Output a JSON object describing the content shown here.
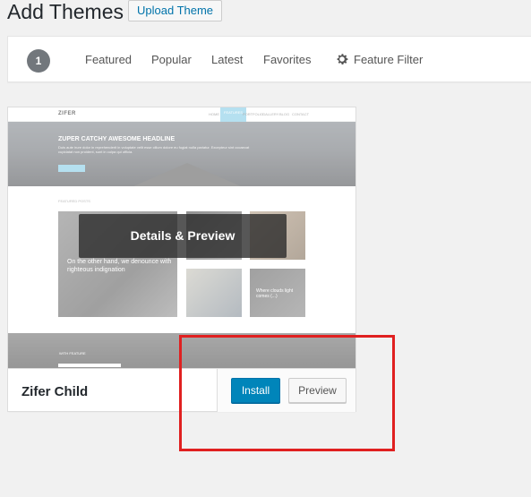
{
  "page": {
    "title": "Add Themes",
    "upload_label": "Upload Theme"
  },
  "filter_bar": {
    "count": "1",
    "tabs": [
      "Featured",
      "Popular",
      "Latest",
      "Favorites"
    ],
    "feature_filter_label": "Feature Filter"
  },
  "theme_card": {
    "name": "Zifer Child",
    "overlay_label": "Details & Preview",
    "install_label": "Install",
    "preview_label": "Preview",
    "screenshot": {
      "logo": "ZIFER",
      "nav_items": [
        "HOME",
        "FEATURES",
        "PORTFOLIO",
        "GALLERY",
        "BLOG",
        "CONTACT"
      ],
      "hero_title": "ZUPER CATCHY AWESOME HEADLINE",
      "hero_text": "Duis aute irure dolor in reprehenderit in voluptate velit esse cillum dolore eu fugiat nulla pariatur. Excepteur sint occaecat cupidatat non proident, sunt in culpa qui officia.",
      "posts_label": "FEATURED POSTS",
      "post_big_text": "On the other hand, we denounce with righteous indignation",
      "post_small_text": "Where clouds light comes (...)",
      "band_label": "WITH FEATURE"
    }
  },
  "colors": {
    "install_blue": "#0085ba",
    "annotation_red": "#e02020",
    "link_blue": "#0073aa"
  }
}
